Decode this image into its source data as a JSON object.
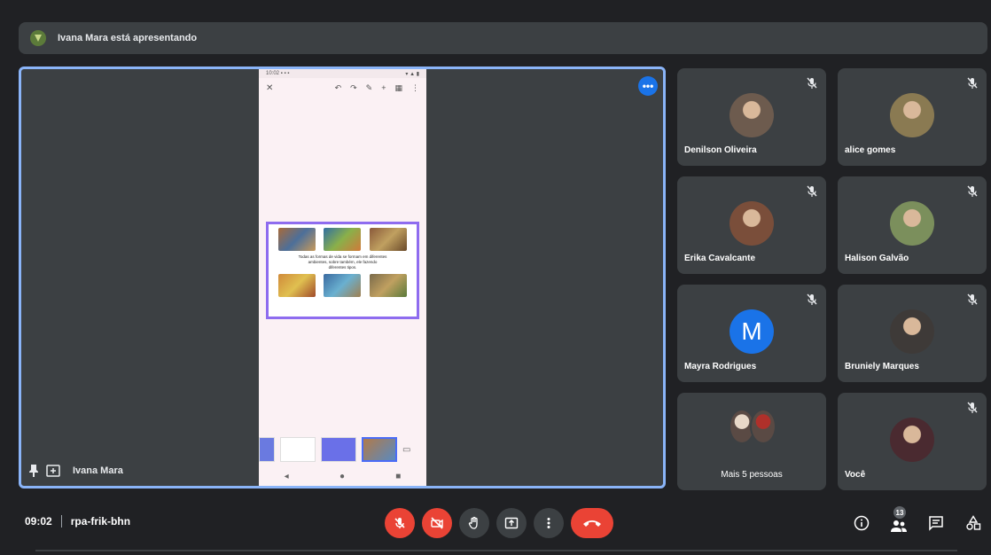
{
  "banner": {
    "text": "Ivana Mara está apresentando"
  },
  "stage": {
    "presenter_name": "Ivana Mara",
    "more_label": "•••",
    "phone": {
      "status_left": "10:02 ▪ ▪ ▪",
      "status_right": "▾ ▲ ▮",
      "close": "✕",
      "slide_caption_1": "Todas as formas de vida se formam em diferentes",
      "slide_caption_2": "ambientes, sobre também, ele fazendo",
      "slide_caption_3": "diferentes tipos."
    }
  },
  "participants": [
    {
      "name": "Denilson Oliveira",
      "muted": true,
      "avatar": "photo",
      "color": "#6d5b4e"
    },
    {
      "name": "alice gomes",
      "muted": true,
      "avatar": "photo",
      "color": "#8a7a52"
    },
    {
      "name": "Erika Cavalcante",
      "muted": true,
      "avatar": "photo",
      "color": "#7a4e3a"
    },
    {
      "name": "Halison Galvão",
      "muted": true,
      "avatar": "photo",
      "color": "#7b8f5c"
    },
    {
      "name": "Mayra Rodrigues",
      "muted": true,
      "avatar": "letter",
      "letter": "M",
      "color": "#1a73e8"
    },
    {
      "name": "Bruniely Marques",
      "muted": true,
      "avatar": "photo",
      "color": "#3e3a38"
    },
    {
      "name": "Mais 5 pessoas",
      "muted": false,
      "avatar": "stack",
      "color": "#5a4a44"
    },
    {
      "name": "Você",
      "muted": true,
      "avatar": "photo",
      "color": "#4a2a30"
    }
  ],
  "bottom": {
    "time": "09:02",
    "meeting_code": "rpa-frik-bhn",
    "people_count": "13"
  },
  "colors": {
    "accent": "#8ab4f8",
    "danger": "#ea4335",
    "tile": "#3c4043",
    "bg": "#202124"
  }
}
